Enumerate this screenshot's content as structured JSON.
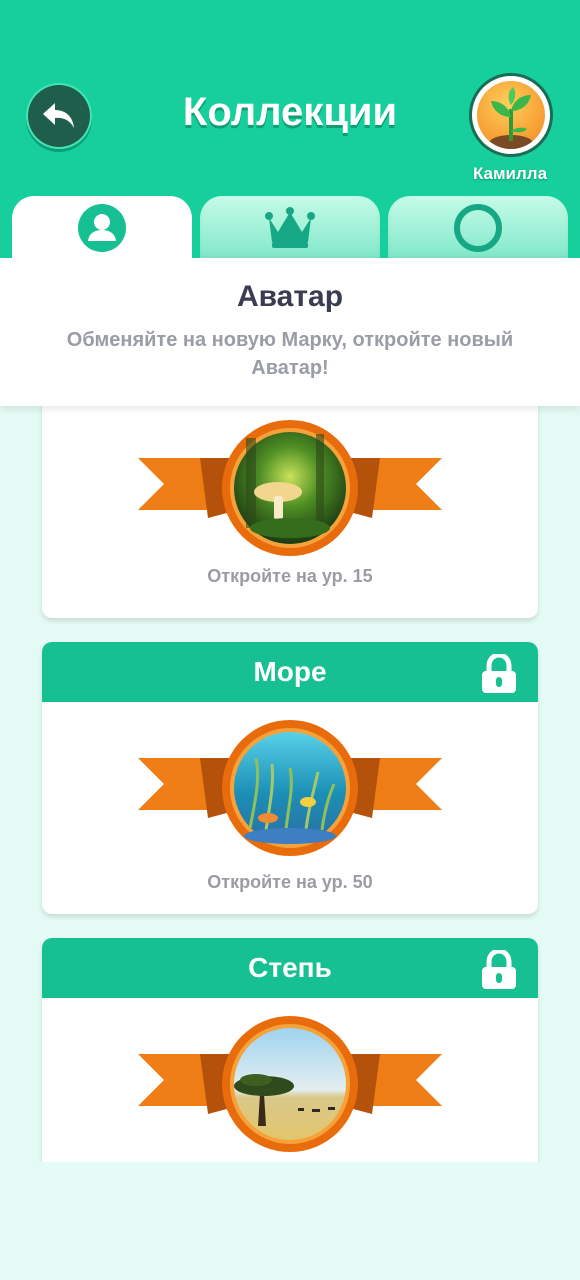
{
  "header": {
    "title": "Коллекции",
    "username": "Камилла",
    "back_icon": "back-arrow-icon",
    "avatar_icon": "sprout-icon",
    "color": "#16cf9c"
  },
  "tabs": [
    {
      "icon": "user-icon",
      "active": true
    },
    {
      "icon": "crown-icon",
      "active": false
    },
    {
      "icon": "circle-icon",
      "active": false
    }
  ],
  "section": {
    "title": "Аватар",
    "subtitle": "Обменяйте на новую Марку, откройте новый Аватар!"
  },
  "cards": [
    {
      "title": "",
      "theme": "forest-mushroom",
      "unlock_text": "Откройте на ур. 15",
      "locked": true
    },
    {
      "title": "Море",
      "theme": "sea",
      "unlock_text": "Откройте на ур. 50",
      "locked": true
    },
    {
      "title": "Степь",
      "theme": "steppe",
      "unlock_text": "",
      "locked": true
    }
  ]
}
